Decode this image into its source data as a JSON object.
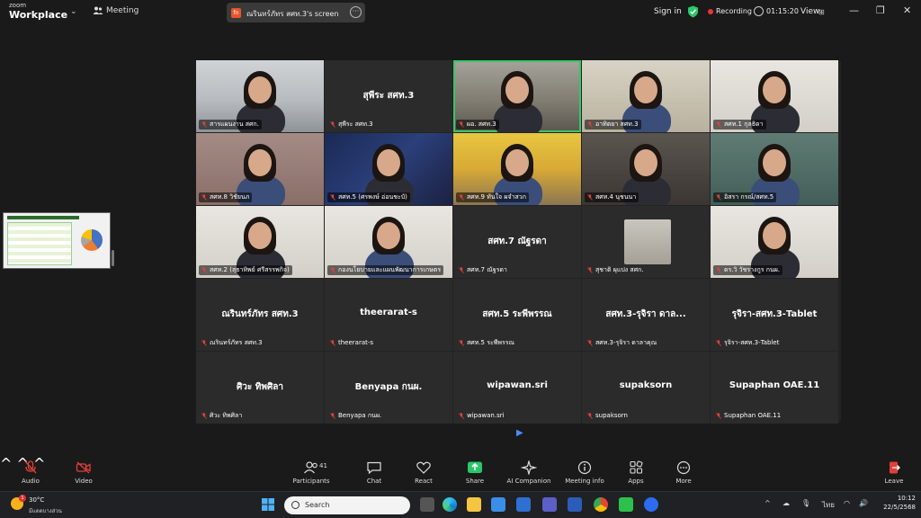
{
  "topbar": {
    "brand_small": "zoom",
    "brand_big": "Workplace",
    "meeting_label": "Meeting",
    "share_title": "ณรินทร์ภัทร สศท.3's screen",
    "signin": "Sign in",
    "recording": "Recording",
    "timer": "01:15:20",
    "view": "View"
  },
  "tiles": [
    {
      "name": "สารแผนงาน สศก.",
      "center": "",
      "video": "v-office"
    },
    {
      "name": "สุพีระ สศท.3",
      "center": "สุพีระ สศท.3",
      "video": ""
    },
    {
      "name": "ผอ. สศท.3",
      "center": "",
      "video": "v-office2"
    },
    {
      "name": "อาทิตยา สศท.3",
      "center": "",
      "video": "v-green"
    },
    {
      "name": "สศท.1 กุลธิดา",
      "center": "",
      "video": "v-white"
    },
    {
      "name": "สศท.8 วิชัยนภ",
      "center": "",
      "video": "v-pink"
    },
    {
      "name": "สศท.5 (ศรพงษ์ อ่อนชะบั)",
      "center": "",
      "video": "v-blue"
    },
    {
      "name": "สศท.9 ทันใจ ผจำสวก",
      "center": "",
      "video": "v-yellow"
    },
    {
      "name": "สศท.4 นุชนนา",
      "center": "",
      "video": "v-dark"
    },
    {
      "name": "อิสรา กรณ์/สศท.5",
      "center": "",
      "video": "v-teal"
    },
    {
      "name": "สศท.2 (สุธาทิพย์ ศรีสรรพกิจ)",
      "center": "",
      "video": "v-white"
    },
    {
      "name": "กองนโยบายและแผนพัฒนาการเกษตร",
      "center": "",
      "video": "v-white"
    },
    {
      "name": "สศท.7 ณัฐรดา",
      "center": "สศท.7 ณัฐรดา",
      "video": ""
    },
    {
      "name": "สุชาติ ผุแปง สศก.",
      "center": "",
      "video": ""
    },
    {
      "name": "ดร.วิ วัชรางกูร กนผ.",
      "center": "",
      "video": "v-white"
    },
    {
      "name": "ณรินทร์ภัทร สศท.3",
      "center": "ณรินทร์ภัทร สศท.3",
      "video": ""
    },
    {
      "name": "theerarat-s",
      "center": "theerarat-s",
      "video": ""
    },
    {
      "name": "สศท.5 ระพีพรรณ",
      "center": "สศท.5 ระพีพรรณ",
      "video": ""
    },
    {
      "name": "สศท.3-รุจิรา ดาลาคุณ",
      "center": "สศท.3-รุจิรา ดาล...",
      "video": ""
    },
    {
      "name": "รุจิรา-สศท.3-Tablet",
      "center": "รุจิรา-สศท.3-Tablet",
      "video": ""
    },
    {
      "name": "ศิวะ ทิพศิลา",
      "center": "ศิวะ ทิพศิลา",
      "video": ""
    },
    {
      "name": "Benyapa กนผ.",
      "center": "Benyapa กนผ.",
      "video": ""
    },
    {
      "name": "wipawan.sri",
      "center": "wipawan.sri",
      "video": ""
    },
    {
      "name": "supaksorn",
      "center": "supaksorn",
      "video": ""
    },
    {
      "name": "Supaphan OAE.11",
      "center": "Supaphan OAE.11",
      "video": ""
    }
  ],
  "toolbar": {
    "audio": "Audio",
    "video": "Video",
    "participants": "Participants",
    "participants_count": "41",
    "chat": "Chat",
    "react": "React",
    "share": "Share",
    "ai": "AI Companion",
    "info": "Meeting info",
    "apps": "Apps",
    "more": "More",
    "leave": "Leave"
  },
  "taskbar": {
    "temp": "30°C",
    "weather": "มีแดดบางส่วน",
    "badge": "1",
    "search": "Search",
    "lang": "ไทย",
    "time": "10:12",
    "date": "22/5/2568"
  },
  "colors": {
    "active_border": "#3ac46a",
    "recording": "#e33333",
    "muted_mic": "#e0403a",
    "share_green": "#2ac769"
  }
}
